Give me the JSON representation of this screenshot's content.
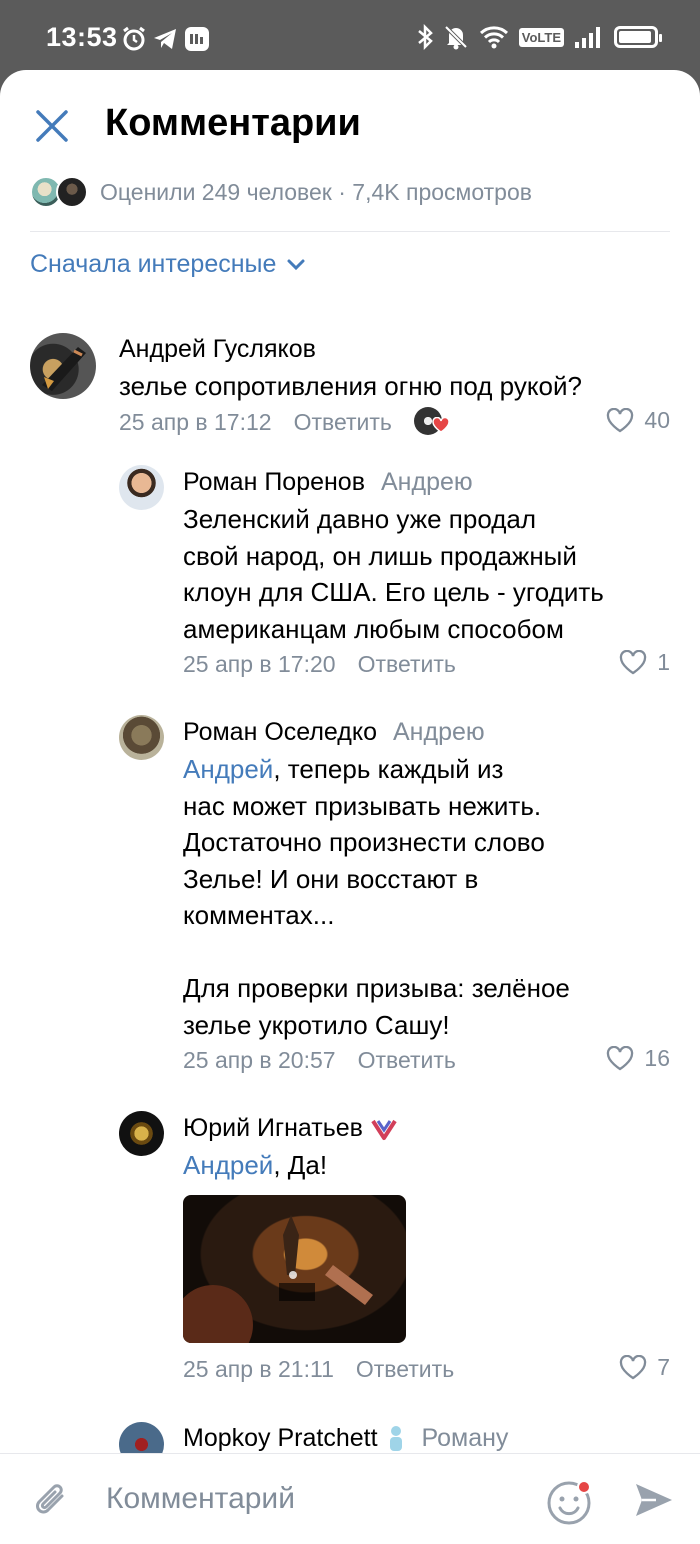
{
  "status_bar": {
    "time": "13:53",
    "volte": "VoLTE"
  },
  "header": {
    "title": "Комментарии"
  },
  "stats": {
    "text": "Оценили 249 человек · 7,4K просмотров"
  },
  "sort": {
    "label": "Сначала интересные"
  },
  "comments": [
    {
      "author": "Андрей Гусляков",
      "reply_to": "",
      "mention": "",
      "text": "зелье сопротивления огню под рукой?",
      "date": "25 апр в 17:12",
      "reply_label": "Ответить",
      "likes": "40"
    },
    {
      "author": "Роман Поренов",
      "reply_to": "Андрею",
      "mention": "",
      "text": "Зеленский давно уже продал\nсвой народ, он лишь продажный\nклоун для США. Его цель - угодить\nамериканцам любым способом",
      "date": "25 апр в 17:20",
      "reply_label": "Ответить",
      "likes": "1"
    },
    {
      "author": "Роман Оселедко",
      "reply_to": "Андрею",
      "mention": "Андрей",
      "text": ", теперь каждый из\nнас может призывать нежить.\nДостаточно произнести слово\nЗелье! И они восстают в\nкомментах...\n\nДля проверки призыва: зелёное\nзелье укротило Сашу!",
      "date": "25 апр в 20:57",
      "reply_label": "Ответить",
      "likes": "16"
    },
    {
      "author": "Юрий Игнатьев",
      "reply_to": "",
      "mention": "Андрей",
      "text": ", Да!",
      "date": "25 апр в 21:11",
      "reply_label": "Ответить",
      "likes": "7"
    },
    {
      "author": "Mopkoy Pratchett",
      "reply_to": "Роману"
    }
  ],
  "input": {
    "placeholder": "Комментарий"
  },
  "colors": {
    "accent": "#447bba",
    "secondary_text": "#818c99",
    "like_heart": "#e64646"
  }
}
